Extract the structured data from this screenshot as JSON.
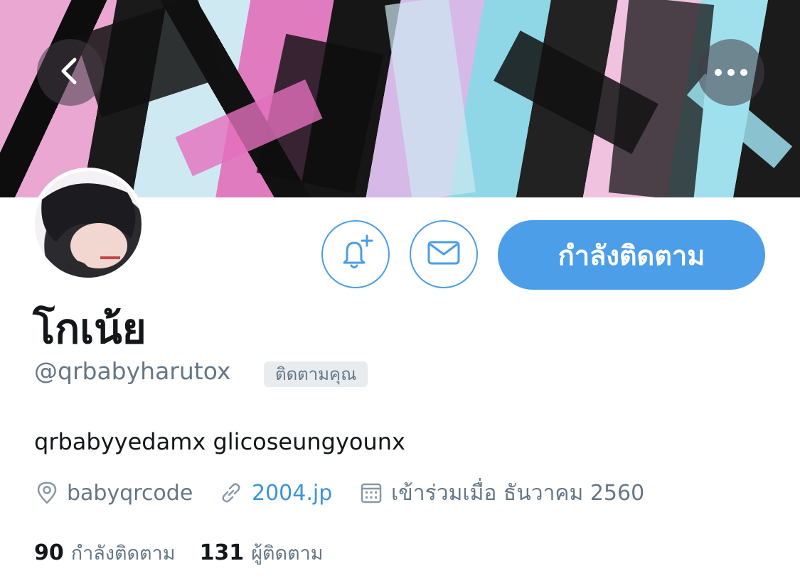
{
  "header": {
    "back_icon": "chevron-left-icon",
    "more_icon": "ellipsis-icon"
  },
  "profile": {
    "display_name": "โกเน้ย",
    "handle": "@qrbabyharutox",
    "follows_you_badge": "ติดตามคุณ",
    "bio": "qrbabyyedamx glicoseungyounx",
    "location": "babyqrcode",
    "website": "2004.jp",
    "joined": "เข้าร่วมเมื่อ ธันวาคม 2560"
  },
  "actions": {
    "notify_icon": "bell-plus-icon",
    "message_icon": "envelope-icon",
    "follow_state_label": "กำลังติดตาม"
  },
  "stats": {
    "following_count": "90",
    "following_label": "กำลังติดตาม",
    "followers_count": "131",
    "followers_label": "ผู้ติดตาม"
  },
  "colors": {
    "accent": "#4c9ee8",
    "secondary_text": "#657786",
    "link": "#3b94d9"
  }
}
